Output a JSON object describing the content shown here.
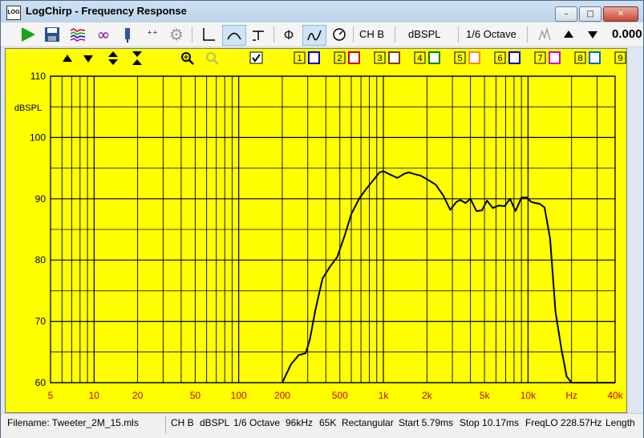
{
  "window": {
    "app_icon_text": "LOG",
    "title": "LogChirp - Frequency Response",
    "minimize_label": "–",
    "maximize_label": "□",
    "close_label": "✕"
  },
  "toolbar": {
    "icons": [
      "play-icon",
      "save-icon",
      "waterfall-icon",
      "infinity-icon",
      "probe-icon",
      "marker-icon",
      "gear-icon",
      "impulse-icon",
      "frequency-icon",
      "step-icon",
      "phase-icon",
      "group-delay-icon",
      "dial-icon"
    ],
    "channel_label": "CH B",
    "units_label": "dBSPL",
    "smoothing_label": "1/6 Octave",
    "readout_value": "0.000"
  },
  "plot_controls": {
    "channels": [
      "1",
      "2",
      "3",
      "4",
      "5",
      "6",
      "7",
      "8",
      "9"
    ],
    "channel_colors": [
      "#0000cc",
      "#cc0000",
      "#7a3b1a",
      "#008800",
      "#ff8800",
      "#0000cc",
      "#cc00cc",
      "#0066cc",
      "#000000"
    ]
  },
  "chart_data": {
    "type": "line",
    "xscale": "log",
    "xlim": [
      5,
      40000
    ],
    "ylim": [
      60,
      110
    ],
    "ylabel": "dBSPL",
    "x_ticks": [
      {
        "v": 5,
        "label": "5"
      },
      {
        "v": 10,
        "label": "10"
      },
      {
        "v": 20,
        "label": "20"
      },
      {
        "v": 50,
        "label": "50"
      },
      {
        "v": 100,
        "label": "100"
      },
      {
        "v": 200,
        "label": "200"
      },
      {
        "v": 500,
        "label": "500"
      },
      {
        "v": 1000,
        "label": "1k"
      },
      {
        "v": 2000,
        "label": "2k"
      },
      {
        "v": 5000,
        "label": "5k"
      },
      {
        "v": 10000,
        "label": "10k"
      },
      {
        "v": 20000,
        "label": "Hz"
      },
      {
        "v": 40000,
        "label": "40k"
      }
    ],
    "y_ticks": [
      {
        "v": 110,
        "label": "110"
      },
      {
        "v": 100,
        "label": "100"
      },
      {
        "v": 90,
        "label": "90"
      },
      {
        "v": 80,
        "label": "80"
      },
      {
        "v": 70,
        "label": "70"
      },
      {
        "v": 60,
        "label": "60"
      }
    ],
    "grid": true,
    "series": [
      {
        "x": [
          200,
          230,
          260,
          290,
          310,
          340,
          380,
          430,
          480,
          540,
          600,
          680,
          760,
          850,
          940,
          1000,
          1100,
          1250,
          1400,
          1500,
          1650,
          1800,
          2000,
          2300,
          2600,
          2900,
          3200,
          3400,
          3700,
          4000,
          4400,
          4800,
          5200,
          5700,
          6300,
          6900,
          7500,
          8200,
          9000,
          9800,
          10500,
          11200,
          12000,
          13000,
          14200,
          15500,
          17000,
          18500,
          20000,
          22000,
          24000,
          26000,
          28000,
          30000,
          32000,
          34000,
          40000
        ],
        "y": [
          60,
          63,
          64.5,
          64.8,
          67,
          72,
          77,
          79,
          80.5,
          84,
          87.5,
          90,
          91.6,
          93,
          94.3,
          94.5,
          94,
          93.4,
          94.1,
          94.3,
          94,
          93.8,
          93.2,
          92.3,
          90.5,
          88.2,
          89.5,
          89.8,
          89.3,
          90,
          88,
          88.1,
          89.7,
          88.5,
          88.9,
          88.8,
          90,
          88,
          90.2,
          90.2,
          89.5,
          89.3,
          89.2,
          88.6,
          83.5,
          71.5,
          65.5,
          61,
          60,
          60,
          60,
          60,
          60,
          60,
          60,
          60,
          60
        ],
        "color": "#000000"
      }
    ]
  },
  "status": {
    "filename": "Filename: Tweeter_2M_15.mls",
    "channel": "CH B",
    "units": "dBSPL",
    "smoothing": "1/6 Octave",
    "sample_rate": "96kHz",
    "size": "65K",
    "window": "Rectangular",
    "start": "Start 5.79ms",
    "stop": "Stop 10.17ms",
    "freqlo": "FreqLO 228.57Hz",
    "length": "Length"
  }
}
